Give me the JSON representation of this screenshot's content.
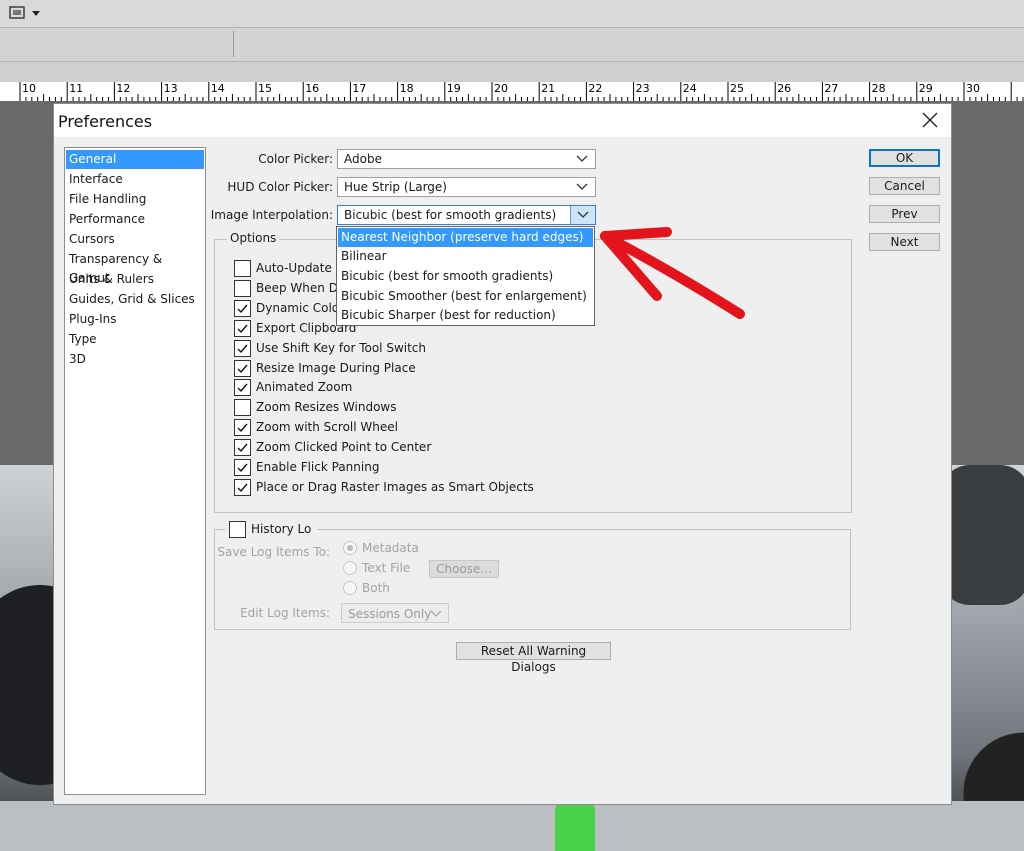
{
  "ruler": {
    "labels": [
      "10",
      "11",
      "12",
      "13",
      "14",
      "15",
      "16",
      "17",
      "18",
      "19",
      "20",
      "21",
      "22",
      "23",
      "24",
      "25",
      "26",
      "27",
      "28",
      "29",
      "30"
    ]
  },
  "dialog": {
    "title": "Preferences",
    "sidebar": [
      "General",
      "Interface",
      "File Handling",
      "Performance",
      "Cursors",
      "Transparency & Gamut",
      "Units & Rulers",
      "Guides, Grid & Slices",
      "Plug-Ins",
      "Type",
      "3D"
    ],
    "color_picker": {
      "label": "Color Picker:",
      "value": "Adobe"
    },
    "hud_color_picker": {
      "label": "HUD Color Picker:",
      "value": "Hue Strip (Large)"
    },
    "image_interpolation": {
      "label": "Image Interpolation:",
      "value": "Bicubic (best for smooth gradients)",
      "options": [
        "Nearest Neighbor (preserve hard edges)",
        "Bilinear",
        "Bicubic (best for smooth gradients)",
        "Bicubic Smoother (best for enlargement)",
        "Bicubic Sharper (best for reduction)"
      ],
      "highlighted_option": "Nearest Neighbor (preserve hard edges)"
    },
    "options_group": {
      "title": "Options",
      "checkboxes": [
        {
          "label": "Auto-Update O",
          "checked": false
        },
        {
          "label": "Beep When Do",
          "checked": false
        },
        {
          "label": "Dynamic Color",
          "checked": true
        },
        {
          "label": "Export Clipboard",
          "checked": true
        },
        {
          "label": "Use Shift Key for Tool Switch",
          "checked": true
        },
        {
          "label": "Resize Image During Place",
          "checked": true
        },
        {
          "label": "Animated Zoom",
          "checked": true
        },
        {
          "label": "Zoom Resizes Windows",
          "checked": false
        },
        {
          "label": "Zoom with Scroll Wheel",
          "checked": true
        },
        {
          "label": "Zoom Clicked Point to Center",
          "checked": true
        },
        {
          "label": "Enable Flick Panning",
          "checked": true
        },
        {
          "label": "Place or Drag Raster Images as Smart Objects",
          "checked": true
        }
      ]
    },
    "history_log": {
      "label": "History Lo",
      "checked": false,
      "save_label": "Save Log Items To:",
      "radio_options": [
        "Metadata",
        "Text File",
        "Both"
      ],
      "selected_radio": "Metadata",
      "choose_button": "Choose...",
      "edit_label": "Edit Log Items:",
      "edit_value": "Sessions Only"
    },
    "reset_button": "Reset All Warning Dialogs",
    "buttons": {
      "ok": "OK",
      "cancel": "Cancel",
      "prev": "Prev",
      "next": "Next"
    }
  },
  "colors": {
    "selection": "#3399ff",
    "annotation_arrow": "#e3141b",
    "default_button_border": "#0078d7"
  },
  "icons": [
    "screen-mode-icon",
    "close-icon",
    "chevron-down-icon",
    "checkmark-icon",
    "red-arrow-annotation"
  ]
}
